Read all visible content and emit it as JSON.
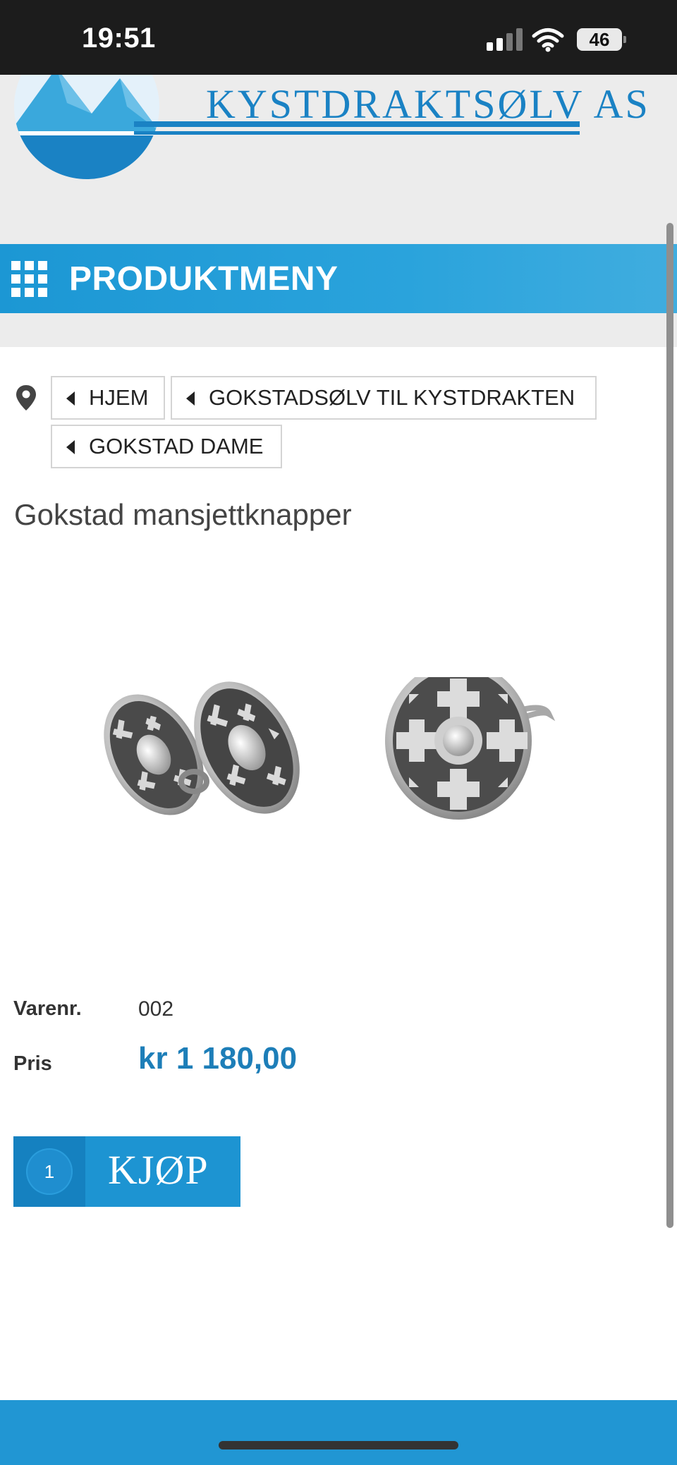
{
  "status_bar": {
    "time": "19:51",
    "battery": "46",
    "icons": [
      "cellular-signal-icon",
      "wifi-icon",
      "battery-icon"
    ]
  },
  "header": {
    "logo_text": "KYSTDRAKTSØLV AS",
    "menu_label": "PRODUKTMENY",
    "menu_icon": "grid-icon"
  },
  "breadcrumb": {
    "icon": "location-pin-icon",
    "items": [
      {
        "label": "HJEM"
      },
      {
        "label": "GOKSTADSØLV TIL KYSTDRAKTEN"
      },
      {
        "label": "GOKSTAD DAME"
      }
    ]
  },
  "product": {
    "title": "Gokstad mansjettknapper",
    "sku_label": "Varenr.",
    "sku_value": "002",
    "price_label": "Pris",
    "price_value": "kr 1 180,00",
    "quantity": "1",
    "buy_label": "KJØP"
  },
  "colors": {
    "brand_blue": "#1c97d4",
    "price_blue": "#1d7eb8",
    "status_bar": "#1c1c1c"
  }
}
